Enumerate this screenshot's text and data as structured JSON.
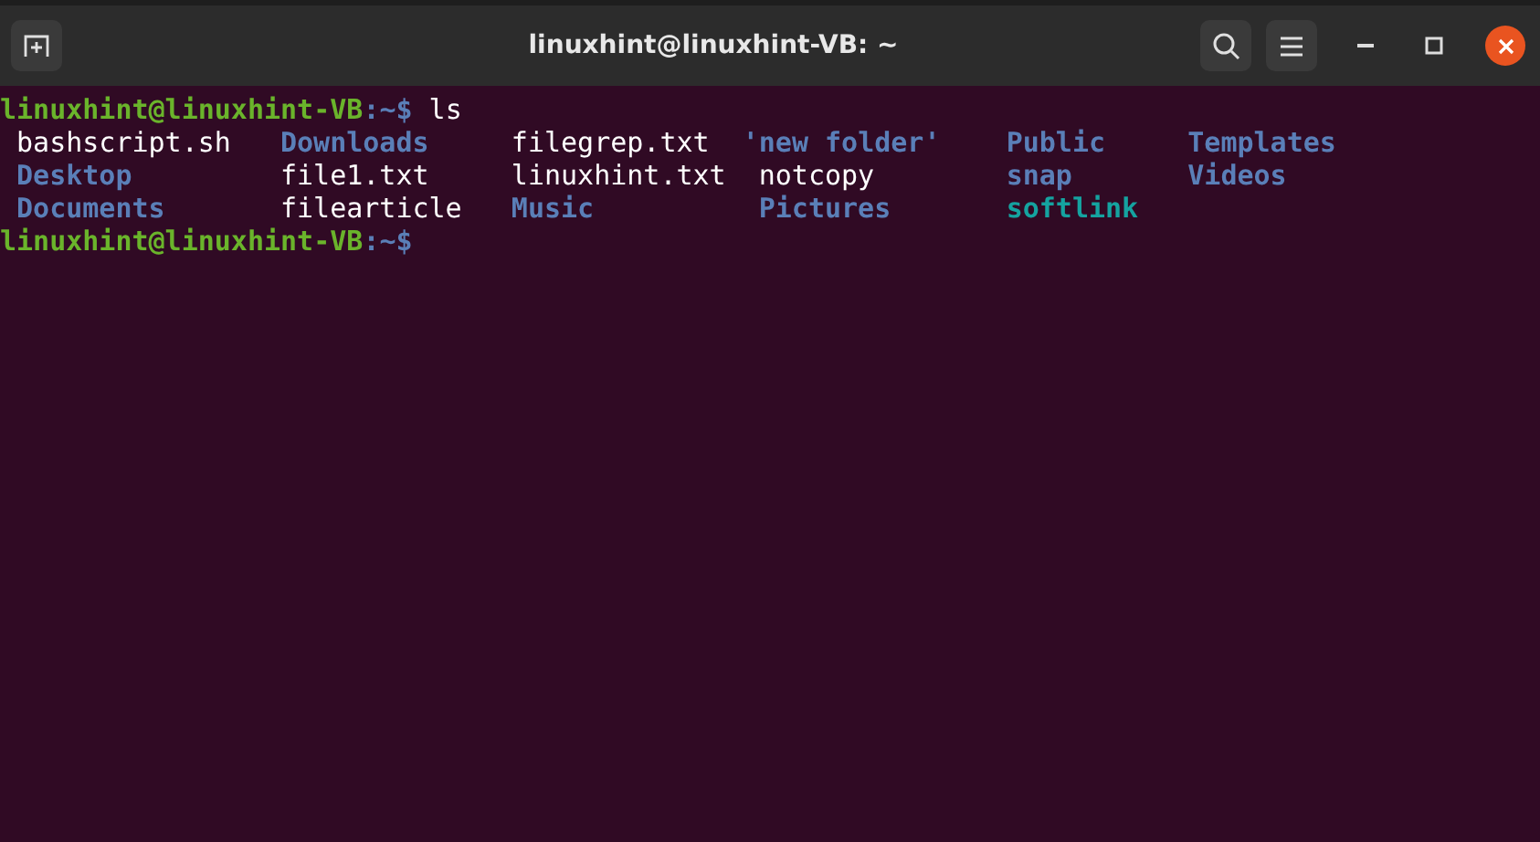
{
  "window": {
    "title": "linuxhint@linuxhint-VB: ~"
  },
  "terminal": {
    "lines": [
      {
        "kind": "prompt",
        "user": "linuxhint@linuxhint-VB",
        "path": ":~$",
        "command": "ls"
      },
      {
        "kind": "listing",
        "entries": [
          {
            "name": "bashscript.sh",
            "kind": "file"
          },
          {
            "name": "Desktop",
            "kind": "dir"
          },
          {
            "name": "Documents",
            "kind": "dir"
          },
          {
            "name": "Downloads",
            "kind": "dir"
          },
          {
            "name": "file1.txt",
            "kind": "file"
          },
          {
            "name": "filearticle",
            "kind": "file"
          },
          {
            "name": "filegrep.txt",
            "kind": "file"
          },
          {
            "name": "linuxhint.txt",
            "kind": "file"
          },
          {
            "name": "Music",
            "kind": "dir"
          },
          {
            "name": "'new folder'",
            "kind": "dir-quoted"
          },
          {
            "name": "notcopy",
            "kind": "file"
          },
          {
            "name": "Pictures",
            "kind": "dir"
          },
          {
            "name": "Public",
            "kind": "dir"
          },
          {
            "name": "snap",
            "kind": "dir"
          },
          {
            "name": "softlink",
            "kind": "link"
          },
          {
            "name": "Templates",
            "kind": "dir"
          },
          {
            "name": "Videos",
            "kind": "dir"
          }
        ]
      },
      {
        "kind": "prompt",
        "user": "linuxhint@linuxhint-VB",
        "path": ":~$"
      }
    ]
  }
}
